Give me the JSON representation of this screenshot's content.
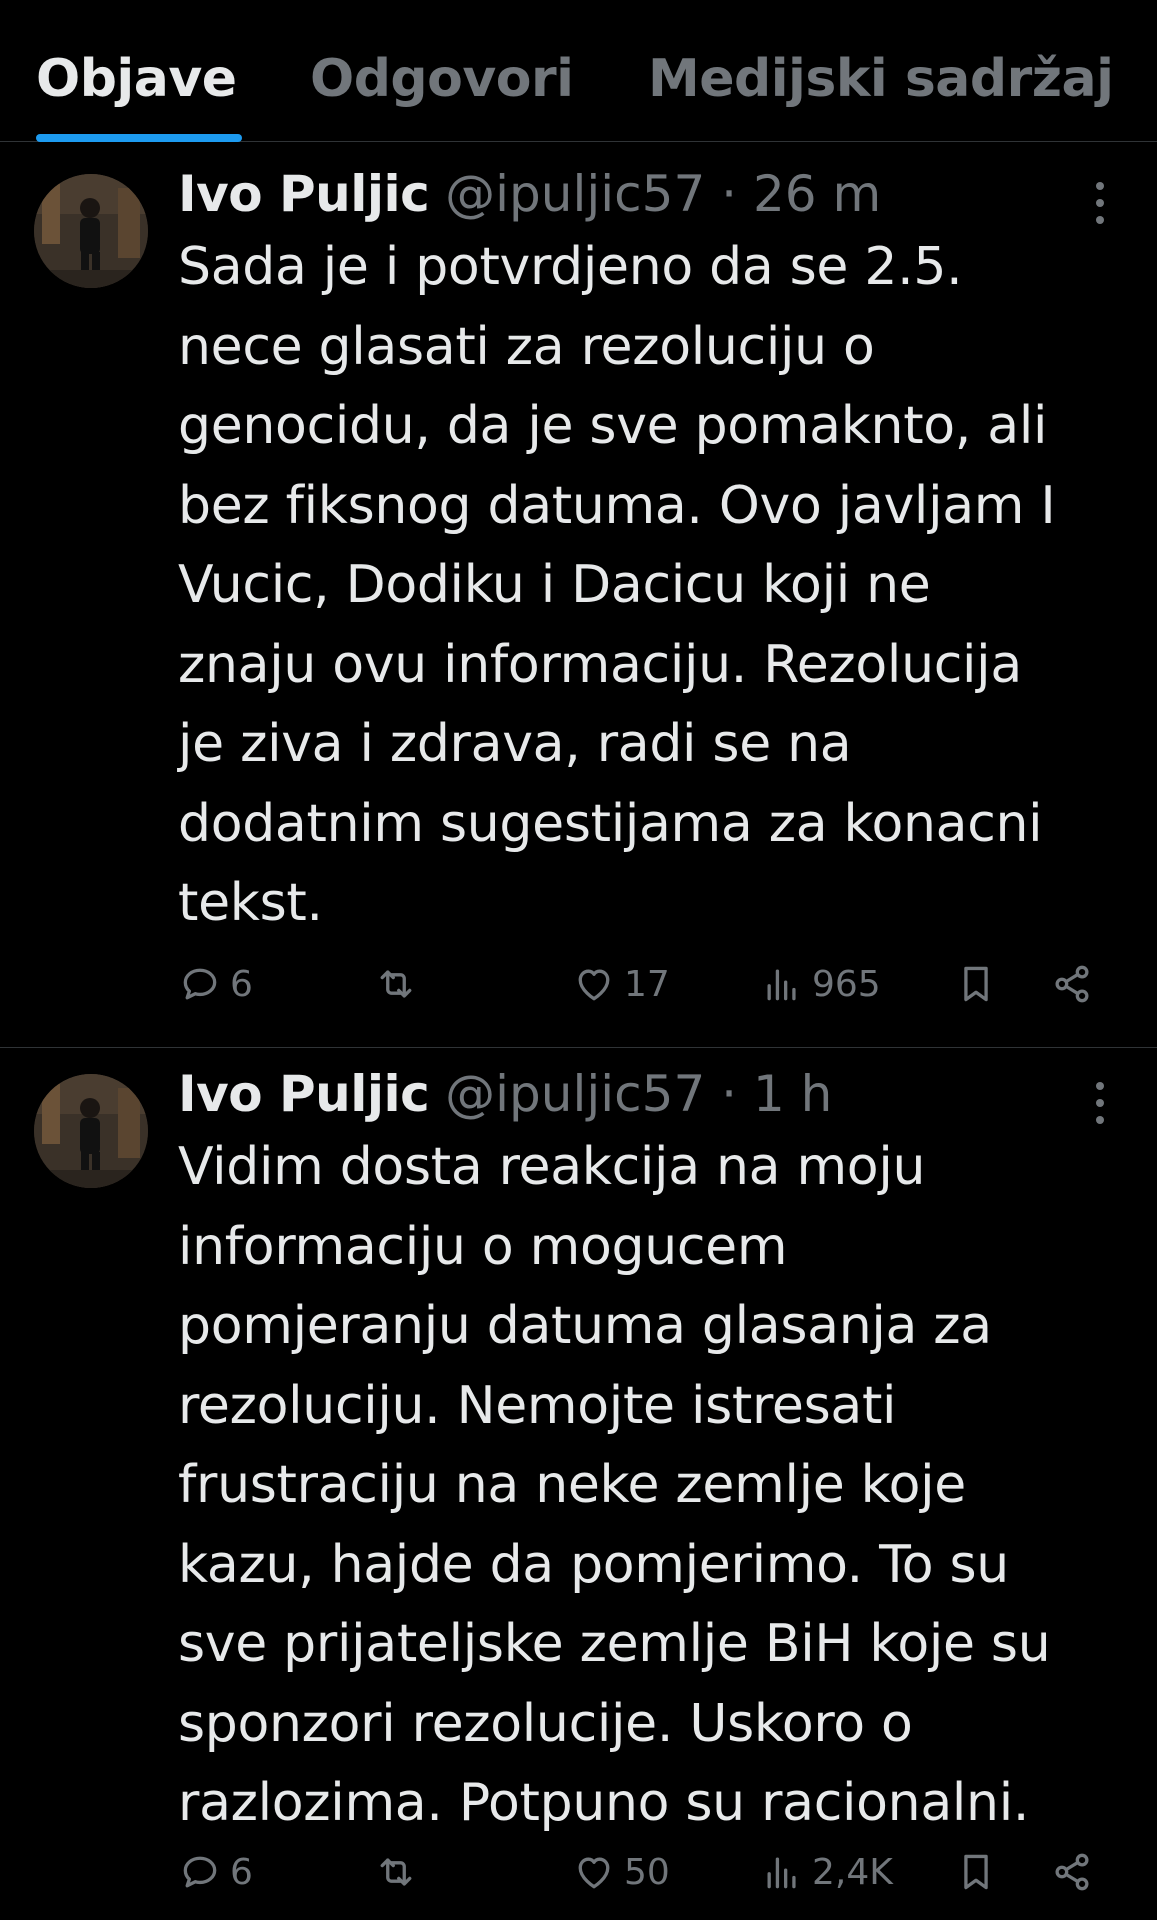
{
  "tabs": [
    {
      "label": "Objave",
      "active": true
    },
    {
      "label": "Odgovori",
      "active": false
    },
    {
      "label": "Medijski sadržaj",
      "active": false
    }
  ],
  "colors": {
    "accent": "#1d9bf0",
    "text": "#e7e9ea",
    "muted": "#71767b",
    "background": "#000000",
    "divider": "#2f3336"
  },
  "tweets": [
    {
      "name": "Ivo Puljic",
      "handle": "@ipuljic57",
      "separator": "·",
      "time": "26 m",
      "text": "Sada je i potvrdjeno da se 2.5.\nnece glasati za rezoluciju o\ngenocidu, da je sve pomaknto, ali\nbez fiksnog datuma. Ovo javljam I\nVucic, Dodiku i Dacicu koji ne\nznaju ovu informaciju. Rezolucija\nje ziva i zdrava, radi se na\ndodatnim sugestijama za konacni\ntekst.",
      "replies": "6",
      "likes": "17",
      "views": "965",
      "icons": [
        "reply-icon",
        "retweet-icon",
        "like-icon",
        "views-icon",
        "bookmark-icon",
        "share-icon"
      ]
    },
    {
      "name": "Ivo Puljic",
      "handle": "@ipuljic57",
      "separator": "·",
      "time": "1 h",
      "text": "Vidim dosta reakcija na moju\ninformaciju o mogucem\npomjeranju datuma glasanja za\nrezoluciju. Nemojte istresati\nfrustraciju na neke zemlje koje\nkazu, hajde da pomjerimo. To su\nsve prijateljske zemlje BiH koje su\nsponzori rezolucije. Uskoro o\nrazlozima. Potpuno su racionalni.",
      "replies": "6",
      "likes": "50",
      "views": "2,4K",
      "icons": [
        "reply-icon",
        "retweet-icon",
        "like-icon",
        "views-icon",
        "bookmark-icon",
        "share-icon"
      ]
    }
  ]
}
